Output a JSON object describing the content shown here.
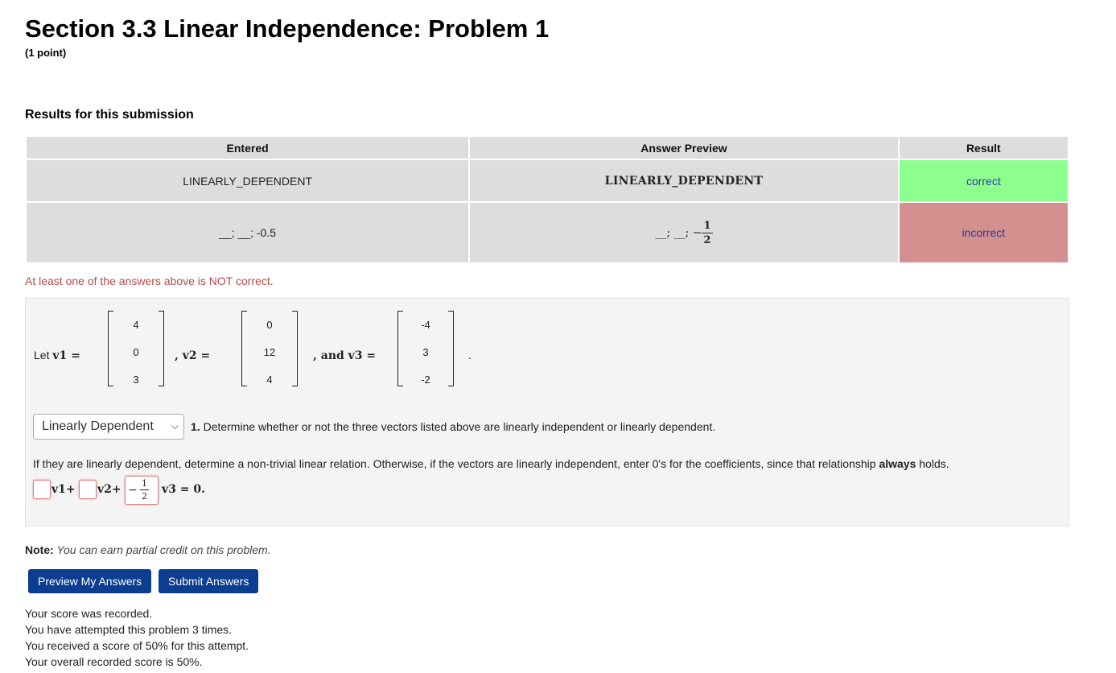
{
  "header": {
    "title": "Section 3.3 Linear Independence: Problem 1",
    "points": "(1 point)"
  },
  "results": {
    "title": "Results for this submission",
    "columns": [
      "Entered",
      "Answer Preview",
      "Result"
    ],
    "rows": [
      {
        "entered": "LINEARLY_DEPENDENT",
        "preview": "LINEARLY_DEPENDENT",
        "result": "correct"
      },
      {
        "entered": "__; __; -0.5",
        "preview_prefix": "__; __; −",
        "preview_num": "1",
        "preview_den": "2",
        "result": "incorrect"
      }
    ],
    "warning": "At least one of the answers above is NOT correct."
  },
  "problem": {
    "let_label": "Let",
    "v1_label": "v1 =",
    "v2_label": ", v2 =",
    "v3_label": ", and v3 =",
    "period": ".",
    "v1": [
      "4",
      "0",
      "3"
    ],
    "v2": [
      "0",
      "12",
      "4"
    ],
    "v3": [
      "-4",
      "3",
      "-2"
    ],
    "select_value": "Linearly Dependent",
    "q1_number": "1.",
    "q1_text": " Determine whether or not the three vectors listed above are linearly independent or linearly dependent.",
    "q2_text_a": "If they are linearly dependent, determine a non-trivial linear relation. Otherwise, if the vectors are linearly independent, enter 0's for the coefficients, since that relationship ",
    "q2_bold": "always",
    "q2_text_b": " holds.",
    "rel_v1": "v1+",
    "rel_v2": "v2+",
    "rel_v3": "v3 = 0.",
    "c3_sign": "−",
    "c3_num": "1",
    "c3_den": "2"
  },
  "footer": {
    "note_label": "Note:",
    "note_text": " You can earn partial credit on this problem.",
    "preview_button": "Preview My Answers",
    "submit_button": "Submit Answers",
    "status_lines": [
      "Your score was recorded.",
      "You have attempted this problem 3 times.",
      "You received a score of 50% for this attempt.",
      "Your overall recorded score is 50%."
    ]
  },
  "colors": {
    "correct_bg": "#8cff8c",
    "incorrect_bg": "#d48f8f",
    "button_bg": "#0b3d91",
    "warning_text": "#b44a4a"
  }
}
